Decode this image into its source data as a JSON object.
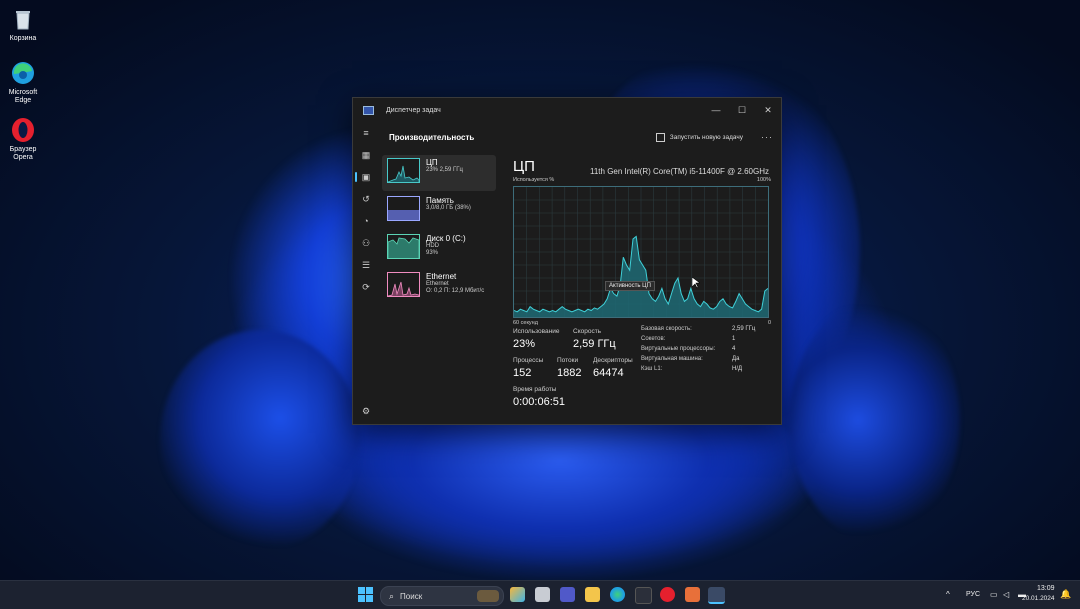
{
  "desktop": {
    "icons": [
      {
        "label": "Корзина",
        "icon": "recycle-bin-icon"
      },
      {
        "label": "Microsoft Edge",
        "icon": "edge-icon"
      },
      {
        "label": "Браузер Opera",
        "icon": "opera-icon"
      }
    ]
  },
  "window": {
    "title": "Диспетчер задач",
    "controls": {
      "minimize": "—",
      "maximize": "☐",
      "close": "✕"
    },
    "header": {
      "title": "Производительность",
      "run_new_task": "Запустить новую задачу",
      "more": "···"
    },
    "rail_icons": [
      "hamburger-icon",
      "processes-icon",
      "performance-icon",
      "app-history-icon",
      "startup-icon",
      "users-icon",
      "details-icon",
      "services-icon",
      "settings-icon"
    ],
    "devices": [
      {
        "name": "ЦП",
        "sub1": "23% 2,59 ГГц",
        "sub2": "",
        "sub3": "",
        "color": "#48c9c9",
        "fill": "#1e5a62"
      },
      {
        "name": "Память",
        "sub1": "3,0/8,0 ГБ (38%)",
        "sub2": "",
        "sub3": "",
        "color": "#9aa7ff",
        "fill": "#555fb0"
      },
      {
        "name": "Диск 0 (C:)",
        "sub1": "HDD",
        "sub2": "93%",
        "sub3": "",
        "color": "#5bd3b4",
        "fill": "#2c7a6a"
      },
      {
        "name": "Ethernet",
        "sub1": "Ethernet",
        "sub2": "О: 0,2 П: 12,9 Мбит/с",
        "sub3": "",
        "color": "#f08cc0",
        "fill": "#7a4060"
      }
    ],
    "cpu": {
      "title": "ЦП",
      "model": "11th Gen Intel(R) Core(TM) i5-11400F @ 2.60GHz",
      "usage_label": "Используется %",
      "max_label": "100%",
      "time_label": "60 секунд",
      "min_label": "0",
      "tooltip": "Активность ЦП",
      "stats": {
        "usage_label": "Использование",
        "usage": "23%",
        "speed_label": "Скорость",
        "speed": "2,59 ГГц",
        "processes_label": "Процессы",
        "processes": "152",
        "threads_label": "Потоки",
        "threads": "1882",
        "handles_label": "Дескрипторы",
        "handles": "64474",
        "uptime_label": "Время работы",
        "uptime": "0:00:06:51"
      },
      "details": [
        {
          "k": "Базовая скорость:",
          "v": "2,59 ГГц"
        },
        {
          "k": "Сокетов:",
          "v": "1"
        },
        {
          "k": "Виртуальные процессоры:",
          "v": "4"
        },
        {
          "k": "Виртуальная машина:",
          "v": "Да"
        },
        {
          "k": "Кэш L1:",
          "v": "Н/Д"
        }
      ]
    }
  },
  "chart_data": {
    "type": "area",
    "ylim": [
      0,
      100
    ],
    "values": [
      5,
      4,
      6,
      5,
      4,
      8,
      6,
      5,
      4,
      6,
      5,
      4,
      5,
      4,
      6,
      8,
      6,
      5,
      4,
      5,
      6,
      5,
      4,
      6,
      5,
      7,
      6,
      8,
      10,
      14,
      22,
      18,
      16,
      24,
      46,
      40,
      36,
      60,
      62,
      44,
      40,
      36,
      18,
      14,
      12,
      16,
      22,
      14,
      10,
      18,
      26,
      30,
      18,
      12,
      14,
      22,
      14,
      10,
      8,
      12,
      10,
      7,
      6,
      8,
      12,
      14,
      10,
      8,
      7,
      12,
      18,
      14,
      10,
      8,
      6,
      5,
      4,
      6,
      20,
      22
    ]
  },
  "taskbar": {
    "search_placeholder": "Поиск",
    "lang": "РУС",
    "time": "13:09",
    "date": "20.01.2024"
  }
}
